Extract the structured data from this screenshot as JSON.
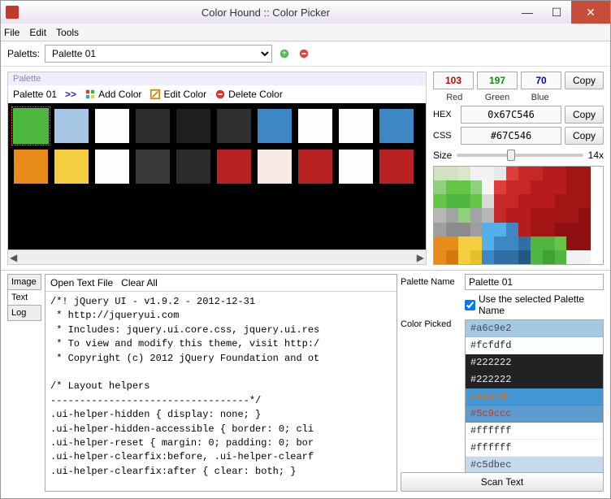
{
  "window": {
    "title": "Color Hound :: Color Picker"
  },
  "menu": {
    "file": "File",
    "edit": "Edit",
    "tools": "Tools"
  },
  "palettes_row": {
    "label": "Paletts:",
    "selected": "Palette 01"
  },
  "palette_panel": {
    "header": "Palette",
    "name": "Palette 01",
    "arrows": ">>",
    "add": "Add Color",
    "edit": "Edit Color",
    "delete": "Delete Color",
    "swatches": [
      "#4fb63f",
      "#a5c6e4",
      "#fdfdfd",
      "#2d2d2d",
      "#1f1f1f",
      "#2f2f2f",
      "#3d88c4",
      "#fdfdfd",
      "#fdfdfd",
      "#3d88c4",
      "#e88b1a",
      "#f3cf3f",
      "#fdfdfd",
      "#3a3a3a",
      "#2b2b2b",
      "#b82222",
      "#f7e9e5",
      "#b82222",
      "#fdfdfd",
      "#b82222"
    ]
  },
  "color_values": {
    "r": "103",
    "g": "197",
    "b": "70",
    "r_label": "Red",
    "g_label": "Green",
    "b_label": "Blue",
    "hex_label": "HEX",
    "hex": "0x67C546",
    "css_label": "CSS",
    "css": "#67C546",
    "copy": "Copy",
    "size_label": "Size",
    "size_value": "14x"
  },
  "lower_tabs": {
    "image": "Image",
    "text": "Text",
    "log": "Log"
  },
  "text_panel": {
    "open": "Open Text File",
    "clear": "Clear All",
    "content": "/*! jQuery UI - v1.9.2 - 2012-12-31\n * http://jqueryui.com\n * Includes: jquery.ui.core.css, jquery.ui.res\n * To view and modify this theme, visit http:/\n * Copyright (c) 2012 jQuery Foundation and ot\n\n/* Layout helpers\n----------------------------------*/\n.ui-helper-hidden { display: none; }\n.ui-helper-hidden-accessible { border: 0; cli\n.ui-helper-reset { margin: 0; padding: 0; bor\n.ui-helper-clearfix:before, .ui-helper-clearf\n.ui-helper-clearfix:after { clear: both; }"
  },
  "picked_panel": {
    "name_label": "Palette Name",
    "name_value": "Palette 01",
    "use_selected": "Use the selected Palette Name",
    "picked_label": "Color Picked",
    "scan": "Scan Text",
    "items": [
      {
        "hex": "#a6c9e2",
        "fg": "#445"
      },
      {
        "hex": "#fcfdfd",
        "fg": "#222"
      },
      {
        "hex": "#222222",
        "fg": "#eee"
      },
      {
        "hex": "#222222",
        "fg": "#eee"
      },
      {
        "hex": "#4297d7",
        "fg": "#d86b18"
      },
      {
        "hex": "#5c9ccc",
        "fg": "#c0392b"
      },
      {
        "hex": "#ffffff",
        "fg": "#222"
      },
      {
        "hex": "#ffffff",
        "fg": "#222"
      },
      {
        "hex": "#c5dbec",
        "fg": "#445"
      }
    ]
  },
  "preview_pixels": [
    "#cfe3c0",
    "#cfe3c0",
    "#d9e8cc",
    "#f2f2f2",
    "#f2f2f2",
    "#e8e8e8",
    "#e23b3b",
    "#c62828",
    "#c62828",
    "#b71c1c",
    "#b71c1c",
    "#a31515",
    "#a31515",
    "#ffffff",
    "#8ed07f",
    "#65c546",
    "#65c546",
    "#8ed07f",
    "#f5f5f5",
    "#e23b3b",
    "#c62828",
    "#c62828",
    "#b71c1c",
    "#b71c1c",
    "#b71c1c",
    "#a31515",
    "#a31515",
    "#ffffff",
    "#65c546",
    "#4fb63f",
    "#4fb63f",
    "#65c546",
    "#d9d9d9",
    "#c62828",
    "#c62828",
    "#b71c1c",
    "#b71c1c",
    "#b71c1c",
    "#a31515",
    "#a31515",
    "#a31515",
    "#ffffff",
    "#b7b7b7",
    "#a3a3a3",
    "#8ed07f",
    "#a3a3a3",
    "#b7b7b7",
    "#c62828",
    "#b71c1c",
    "#b71c1c",
    "#a31515",
    "#a31515",
    "#a31515",
    "#a31515",
    "#8e1010",
    "#ffffff",
    "#9e9e9e",
    "#8c8c8c",
    "#8c8c8c",
    "#9e9e9e",
    "#53b0e8",
    "#53b0e8",
    "#3d88c4",
    "#b71c1c",
    "#a31515",
    "#a31515",
    "#8e1010",
    "#8e1010",
    "#8e1010",
    "#ffffff",
    "#e88b1a",
    "#e88b1a",
    "#f3cf3f",
    "#f3cf3f",
    "#53b0e8",
    "#3d88c4",
    "#3d88c4",
    "#2f6fa3",
    "#4fb63f",
    "#4fb63f",
    "#65c546",
    "#8e1010",
    "#8e1010",
    "#ffffff",
    "#e88b1a",
    "#d6760e",
    "#f3cf3f",
    "#e6bf2a",
    "#3d88c4",
    "#2f6fa3",
    "#2f6fa3",
    "#25587f",
    "#4fb63f",
    "#3fa232",
    "#4fb63f",
    "#f2f2f2",
    "#f2f2f2",
    "#ffffff"
  ]
}
